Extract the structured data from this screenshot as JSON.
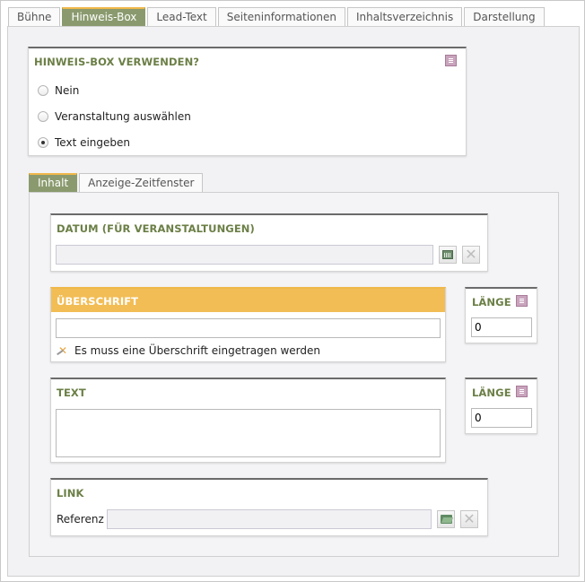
{
  "top_tabs": [
    "Bühne",
    "Hinweis-Box",
    "Lead-Text",
    "Seiteninformationen",
    "Inhaltsverzeichnis",
    "Darstellung"
  ],
  "hinweis": {
    "title": "HINWEIS-BOX VERWENDEN?",
    "options": [
      "Nein",
      "Veranstaltung auswählen",
      "Text eingeben"
    ],
    "selected": "Text eingeben"
  },
  "sub_tabs": [
    "Inhalt",
    "Anzeige-Zeitfenster"
  ],
  "datum": {
    "title": "DATUM (FÜR VERANSTALTUNGEN)",
    "value": ""
  },
  "ueberschrift": {
    "title": "ÜBERSCHRIFT",
    "value": "",
    "error": "Es muss eine Überschrift eingetragen werden"
  },
  "laenge_1": {
    "title": "LÄNGE",
    "value": "0"
  },
  "text": {
    "title": "TEXT",
    "value": ""
  },
  "laenge_2": {
    "title": "LÄNGE",
    "value": "0"
  },
  "link": {
    "title": "LINK",
    "label": "Referenz",
    "value": ""
  },
  "colors": {
    "tab_active": "#8a9a6e",
    "accent_orange": "#f2bd55",
    "title_green": "#6b7f46"
  },
  "icons": [
    "document-icon",
    "calendar-icon",
    "clear-icon",
    "folder-open-icon",
    "warning-icon"
  ]
}
